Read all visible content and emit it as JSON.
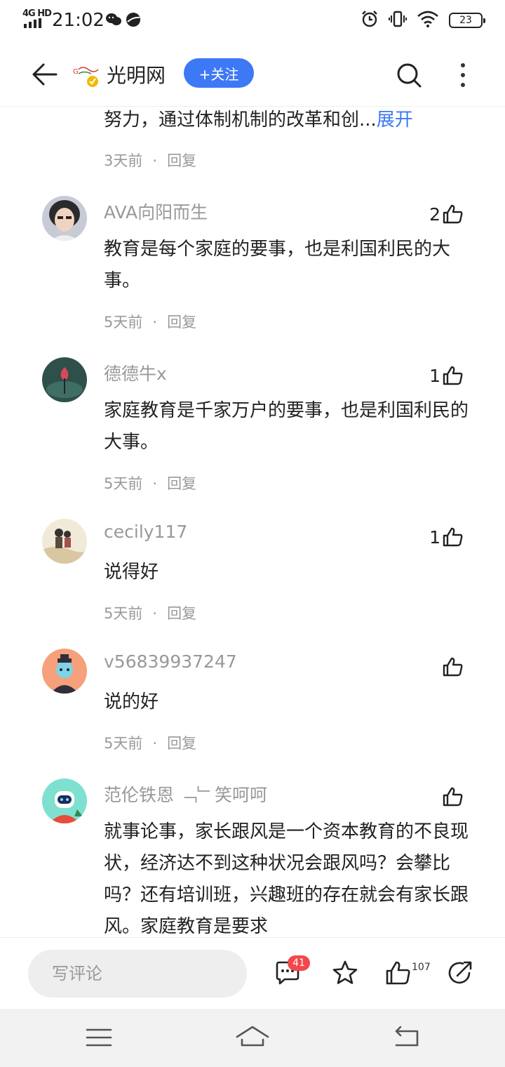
{
  "status_bar": {
    "network": "4G HD",
    "time": "21:02",
    "battery": "23"
  },
  "header": {
    "channel_name": "光明网",
    "follow_label": "+关注"
  },
  "truncated_comment": {
    "text": "努力，通过体制机制的改革和创...",
    "expand_label": "展开",
    "time": "3天前",
    "reply_label": "回复"
  },
  "comments": [
    {
      "username": "AVA向阳而生",
      "likes": "2",
      "text": "教育是每个家庭的要事，也是利国利民的大事。",
      "time": "5天前",
      "reply_label": "回复"
    },
    {
      "username": "德德牛x",
      "likes": "1",
      "text": "家庭教育是千家万户的要事，也是利国利民的大事。",
      "time": "5天前",
      "reply_label": "回复"
    },
    {
      "username": "cecily117",
      "likes": "1",
      "text": "说得好",
      "time": "5天前",
      "reply_label": "回复"
    },
    {
      "username": "v56839937247",
      "likes": "",
      "text": "说的好",
      "time": "5天前",
      "reply_label": "回复"
    },
    {
      "username": "范伦铁恩 ﹁﹂笑呵呵",
      "likes": "",
      "text": "就事论事，家长跟风是一个资本教育的不良现状，经济达不到这种状况会跟风吗？会攀比吗？还有培训班，兴趣班的存在就会有家长跟风。家庭教育是要求",
      "time": "",
      "reply_label": ""
    }
  ],
  "bottom_bar": {
    "comment_placeholder": "写评论",
    "comment_count": "41",
    "like_count": "107"
  },
  "colors": {
    "accent": "#3d78f5",
    "badge": "#f4474b",
    "muted_text": "#999999"
  }
}
